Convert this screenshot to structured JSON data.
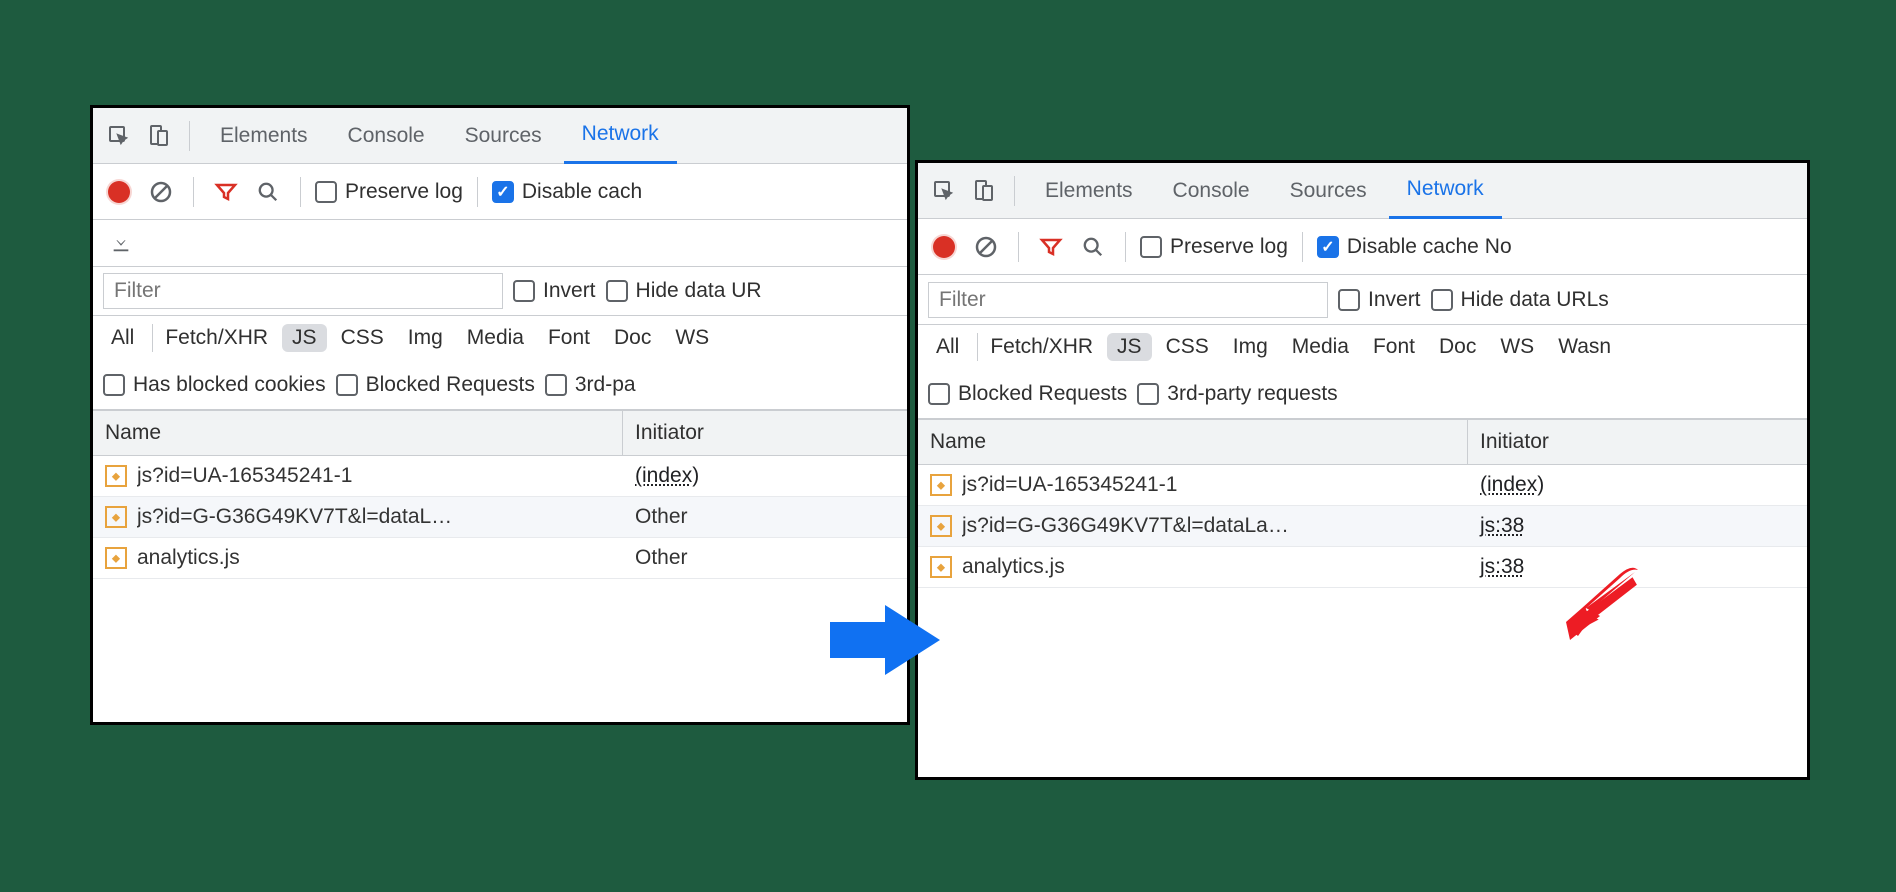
{
  "tabs": {
    "elements": "Elements",
    "console": "Console",
    "sources": "Sources",
    "network": "Network"
  },
  "toolbar": {
    "preserve_log": "Preserve log",
    "disable_cache_left": "Disable cach",
    "disable_cache_right": "Disable cache",
    "no_trail": "No"
  },
  "filter": {
    "placeholder": "Filter",
    "invert": "Invert",
    "hide_data_urls_left": "Hide data UR",
    "hide_data_urls_right": "Hide data URLs"
  },
  "chips": {
    "all": "All",
    "fetch_xhr": "Fetch/XHR",
    "js": "JS",
    "css": "CSS",
    "img": "Img",
    "media": "Media",
    "font": "Font",
    "doc": "Doc",
    "ws": "WS",
    "wasm_trail": "Wasn"
  },
  "options_left": {
    "has_blocked_cookies": "Has blocked cookies",
    "blocked_requests": "Blocked Requests",
    "third_party_trail": "3rd-pa"
  },
  "options_right": {
    "blocked_requests": "Blocked Requests",
    "third_party": "3rd-party requests"
  },
  "columns": {
    "name": "Name",
    "initiator": "Initiator"
  },
  "rows_left": [
    {
      "name": "js?id=UA-165345241-1",
      "initiator": "(index)",
      "link": true
    },
    {
      "name": "js?id=G-G36G49KV7T&l=dataL…",
      "initiator": "Other",
      "link": false
    },
    {
      "name": "analytics.js",
      "initiator": "Other",
      "link": false
    }
  ],
  "rows_right": [
    {
      "name": "js?id=UA-165345241-1",
      "initiator": "(index)",
      "link": true
    },
    {
      "name": "js?id=G-G36G49KV7T&l=dataLa…",
      "initiator": "js:38",
      "link": true
    },
    {
      "name": "analytics.js",
      "initiator": "js:38",
      "link": true
    }
  ]
}
